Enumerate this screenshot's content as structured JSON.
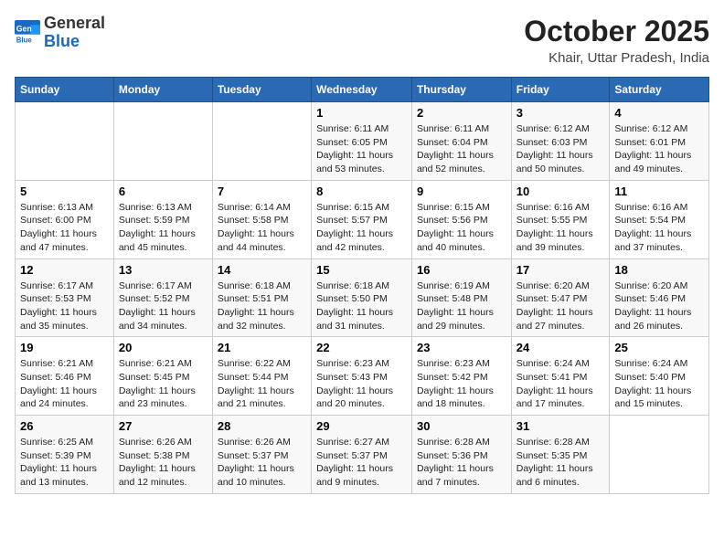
{
  "logo": {
    "general": "General",
    "blue": "Blue"
  },
  "title": "October 2025",
  "location": "Khair, Uttar Pradesh, India",
  "days_of_week": [
    "Sunday",
    "Monday",
    "Tuesday",
    "Wednesday",
    "Thursday",
    "Friday",
    "Saturday"
  ],
  "weeks": [
    [
      {
        "num": "",
        "info": ""
      },
      {
        "num": "",
        "info": ""
      },
      {
        "num": "",
        "info": ""
      },
      {
        "num": "1",
        "info": "Sunrise: 6:11 AM\nSunset: 6:05 PM\nDaylight: 11 hours\nand 53 minutes."
      },
      {
        "num": "2",
        "info": "Sunrise: 6:11 AM\nSunset: 6:04 PM\nDaylight: 11 hours\nand 52 minutes."
      },
      {
        "num": "3",
        "info": "Sunrise: 6:12 AM\nSunset: 6:03 PM\nDaylight: 11 hours\nand 50 minutes."
      },
      {
        "num": "4",
        "info": "Sunrise: 6:12 AM\nSunset: 6:01 PM\nDaylight: 11 hours\nand 49 minutes."
      }
    ],
    [
      {
        "num": "5",
        "info": "Sunrise: 6:13 AM\nSunset: 6:00 PM\nDaylight: 11 hours\nand 47 minutes."
      },
      {
        "num": "6",
        "info": "Sunrise: 6:13 AM\nSunset: 5:59 PM\nDaylight: 11 hours\nand 45 minutes."
      },
      {
        "num": "7",
        "info": "Sunrise: 6:14 AM\nSunset: 5:58 PM\nDaylight: 11 hours\nand 44 minutes."
      },
      {
        "num": "8",
        "info": "Sunrise: 6:15 AM\nSunset: 5:57 PM\nDaylight: 11 hours\nand 42 minutes."
      },
      {
        "num": "9",
        "info": "Sunrise: 6:15 AM\nSunset: 5:56 PM\nDaylight: 11 hours\nand 40 minutes."
      },
      {
        "num": "10",
        "info": "Sunrise: 6:16 AM\nSunset: 5:55 PM\nDaylight: 11 hours\nand 39 minutes."
      },
      {
        "num": "11",
        "info": "Sunrise: 6:16 AM\nSunset: 5:54 PM\nDaylight: 11 hours\nand 37 minutes."
      }
    ],
    [
      {
        "num": "12",
        "info": "Sunrise: 6:17 AM\nSunset: 5:53 PM\nDaylight: 11 hours\nand 35 minutes."
      },
      {
        "num": "13",
        "info": "Sunrise: 6:17 AM\nSunset: 5:52 PM\nDaylight: 11 hours\nand 34 minutes."
      },
      {
        "num": "14",
        "info": "Sunrise: 6:18 AM\nSunset: 5:51 PM\nDaylight: 11 hours\nand 32 minutes."
      },
      {
        "num": "15",
        "info": "Sunrise: 6:18 AM\nSunset: 5:50 PM\nDaylight: 11 hours\nand 31 minutes."
      },
      {
        "num": "16",
        "info": "Sunrise: 6:19 AM\nSunset: 5:48 PM\nDaylight: 11 hours\nand 29 minutes."
      },
      {
        "num": "17",
        "info": "Sunrise: 6:20 AM\nSunset: 5:47 PM\nDaylight: 11 hours\nand 27 minutes."
      },
      {
        "num": "18",
        "info": "Sunrise: 6:20 AM\nSunset: 5:46 PM\nDaylight: 11 hours\nand 26 minutes."
      }
    ],
    [
      {
        "num": "19",
        "info": "Sunrise: 6:21 AM\nSunset: 5:46 PM\nDaylight: 11 hours\nand 24 minutes."
      },
      {
        "num": "20",
        "info": "Sunrise: 6:21 AM\nSunset: 5:45 PM\nDaylight: 11 hours\nand 23 minutes."
      },
      {
        "num": "21",
        "info": "Sunrise: 6:22 AM\nSunset: 5:44 PM\nDaylight: 11 hours\nand 21 minutes."
      },
      {
        "num": "22",
        "info": "Sunrise: 6:23 AM\nSunset: 5:43 PM\nDaylight: 11 hours\nand 20 minutes."
      },
      {
        "num": "23",
        "info": "Sunrise: 6:23 AM\nSunset: 5:42 PM\nDaylight: 11 hours\nand 18 minutes."
      },
      {
        "num": "24",
        "info": "Sunrise: 6:24 AM\nSunset: 5:41 PM\nDaylight: 11 hours\nand 17 minutes."
      },
      {
        "num": "25",
        "info": "Sunrise: 6:24 AM\nSunset: 5:40 PM\nDaylight: 11 hours\nand 15 minutes."
      }
    ],
    [
      {
        "num": "26",
        "info": "Sunrise: 6:25 AM\nSunset: 5:39 PM\nDaylight: 11 hours\nand 13 minutes."
      },
      {
        "num": "27",
        "info": "Sunrise: 6:26 AM\nSunset: 5:38 PM\nDaylight: 11 hours\nand 12 minutes."
      },
      {
        "num": "28",
        "info": "Sunrise: 6:26 AM\nSunset: 5:37 PM\nDaylight: 11 hours\nand 10 minutes."
      },
      {
        "num": "29",
        "info": "Sunrise: 6:27 AM\nSunset: 5:37 PM\nDaylight: 11 hours\nand 9 minutes."
      },
      {
        "num": "30",
        "info": "Sunrise: 6:28 AM\nSunset: 5:36 PM\nDaylight: 11 hours\nand 7 minutes."
      },
      {
        "num": "31",
        "info": "Sunrise: 6:28 AM\nSunset: 5:35 PM\nDaylight: 11 hours\nand 6 minutes."
      },
      {
        "num": "",
        "info": ""
      }
    ]
  ]
}
